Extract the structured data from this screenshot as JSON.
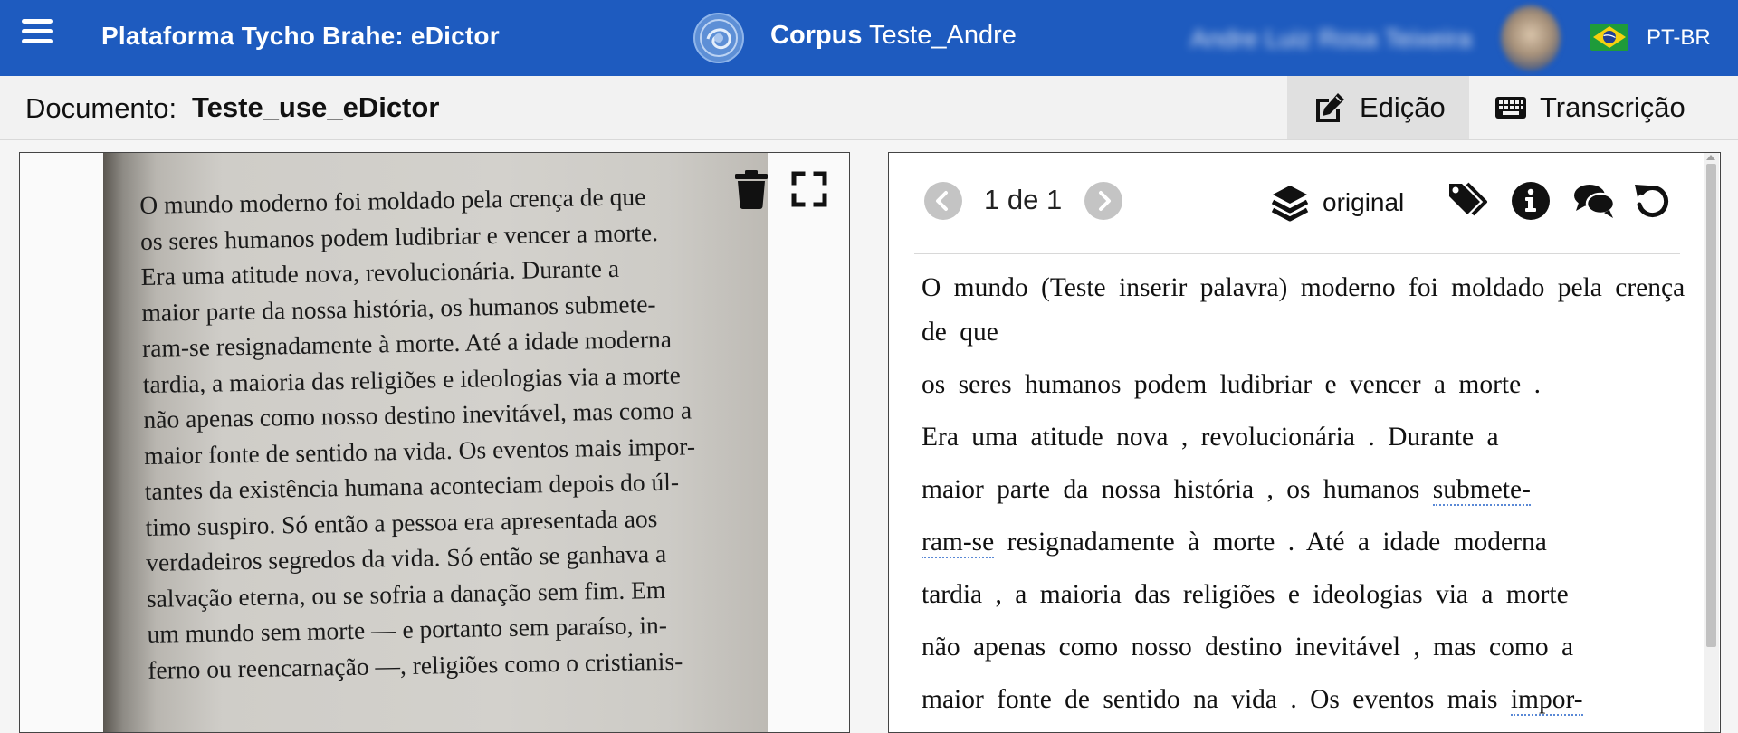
{
  "header": {
    "brand": "Plataforma Tycho Brahe: eDictor",
    "corpus_label": "Corpus",
    "corpus_name": "Teste_Andre",
    "user_name": "Andre Luiz Rosa Teixeira",
    "language": "PT-BR",
    "colors": {
      "bar": "#1e5bbf"
    }
  },
  "document": {
    "label": "Documento:",
    "name": "Teste_use_eDictor"
  },
  "tabs": [
    {
      "label": "Edição",
      "icon": "edit-icon",
      "active": true
    },
    {
      "label": "Transcrição",
      "icon": "keyboard-icon",
      "active": false
    }
  ],
  "image_panel": {
    "page_lines": [
      "O mundo moderno foi moldado pela crença de que",
      "os seres humanos podem ludibriar e vencer a morte.",
      "Era uma atitude nova, revolucionária. Durante a",
      "maior parte da nossa história, os humanos submete-",
      "ram-se resignadamente à morte. Até a idade moderna",
      "tardia, a maioria das religiões e ideologias via a morte",
      "não apenas como nosso destino inevitável, mas como a",
      "maior fonte de sentido na vida. Os eventos mais impor-",
      "tantes da existência humana aconteciam depois do úl-",
      "timo suspiro. Só então a pessoa era apresentada aos",
      "verdadeiros segredos da vida. Só então se ganhava a",
      "salvação eterna, ou se sofria a danação sem fim. Em",
      "um mundo sem morte — e portanto sem paraíso, in-",
      "ferno ou reencarnação —, religiões como o cristianis-"
    ]
  },
  "editor": {
    "pagination": {
      "current": "1 de 1"
    },
    "layer": "original",
    "lines": [
      {
        "text": "O mundo (Teste inserir palavra) moderno foi moldado pela crença de que"
      },
      {
        "text": "os seres humanos podem ludibriar e vencer a morte ."
      },
      {
        "text": "Era uma atitude nova , revolucionária . Durante a"
      },
      {
        "pre": "maior parte da nossa história , os humanos ",
        "hyph": "submete-"
      },
      {
        "hyph": "ram-se",
        "post": " resignadamente à morte . Até a idade moderna"
      },
      {
        "text": "tardia , a maioria das religiões e ideologias via a morte"
      },
      {
        "text": "não apenas como nosso destino inevitável , mas como a"
      },
      {
        "pre": "maior fonte de sentido na vida . Os eventos mais ",
        "hyph": "impor-"
      }
    ]
  }
}
